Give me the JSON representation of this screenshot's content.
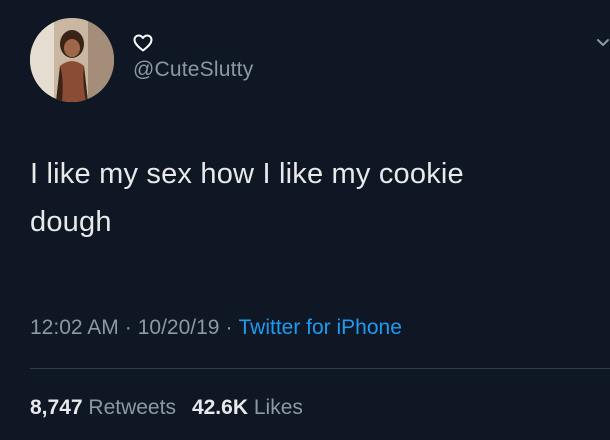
{
  "tweet": {
    "handle": "@CuteSlutty",
    "text_line_1": "I like my sex how I like my cookie",
    "text_line_2": "dough",
    "time": "12:02 AM",
    "date": "10/20/19",
    "separator": "·",
    "source": "Twitter for iPhone",
    "retweets_count": "8,747",
    "retweets_label": "Retweets",
    "likes_count": "42.6K",
    "likes_label": "Likes"
  },
  "icons": {
    "heart": "heart-outline-icon",
    "chevron": "chevron-down-icon"
  },
  "colors": {
    "background": "#0f1624",
    "text": "#e7e9ea",
    "muted": "#8b98a5",
    "link": "#1d9bf0"
  }
}
